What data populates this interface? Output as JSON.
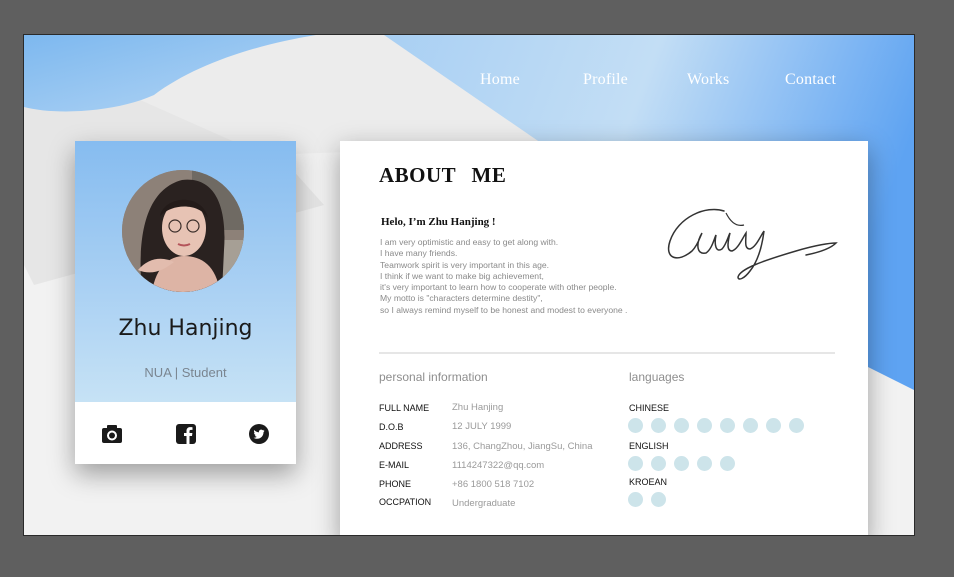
{
  "nav": {
    "items": [
      "Home",
      "Profile",
      "Works",
      "Contact"
    ]
  },
  "profile_card": {
    "name": "Zhu  Hanjing",
    "role": "NUA | Student",
    "social_icons": [
      "camera-icon",
      "facebook-icon",
      "twitter-icon"
    ]
  },
  "about": {
    "title": "ABOUT   ME",
    "greeting": "Helo, I’m Zhu Hanjing !",
    "intro_lines": [
      "I am very optimistic and easy to get along with.",
      "I have many friends.",
      "Teamwork spirit is very important in this age.",
      "I think if we want to make big achievement,",
      "it's very important to learn how to cooperate with other people.",
      "My motto is \"characters determine destity\",",
      "so I always remind myself to be honest and modest to everyone ."
    ],
    "signature_text": "Cany"
  },
  "personal_info": {
    "title": "personal  information",
    "rows": [
      {
        "label": "FULL   NAME",
        "value": "Zhu Hanjing"
      },
      {
        "label": "D.O.B",
        "value": "12  JULY  1999"
      },
      {
        "label": "ADDRESS",
        "value": "136, ChangZhou, JiangSu, China"
      },
      {
        "label": "E-MAIL",
        "value": "1114247322@qq.com"
      },
      {
        "label": "PHONE",
        "value": "+86 1800 518 7102"
      },
      {
        "label": "OCCPATION",
        "value": "Undergraduate"
      }
    ]
  },
  "languages": {
    "title": "languages",
    "items": [
      {
        "name": "CHINESE",
        "level": 8
      },
      {
        "name": "ENGLISH",
        "level": 5
      },
      {
        "name": "KROEAN",
        "level": 2
      }
    ],
    "dot_color": "#cde4ea"
  },
  "colors": {
    "accent_blue": "#5aa2f0",
    "frame_gray": "#5f5f5f"
  }
}
